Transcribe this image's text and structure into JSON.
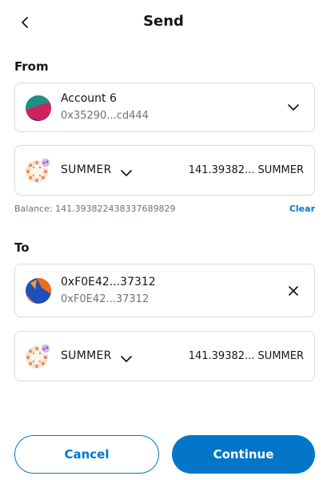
{
  "header": {
    "title": "Send"
  },
  "from": {
    "label": "From",
    "account": {
      "name": "Account 6",
      "address": "0x35290...cd444"
    },
    "token": {
      "symbol": "SUMMER",
      "amount": "141.39382... SUMMER"
    },
    "balance_text": "Balance: 141.393822438337689829",
    "clear_label": "Clear"
  },
  "to": {
    "label": "To",
    "recipient": {
      "name": "0xF0E42...37312",
      "address": "0xF0E42...37312"
    },
    "token": {
      "symbol": "SUMMER",
      "amount": "141.39382... SUMMER"
    }
  },
  "footer": {
    "cancel_label": "Cancel",
    "continue_label": "Continue"
  },
  "colors": {
    "primary": "#0376c9",
    "border": "#d6d9dc",
    "muted": "#6a737d"
  }
}
